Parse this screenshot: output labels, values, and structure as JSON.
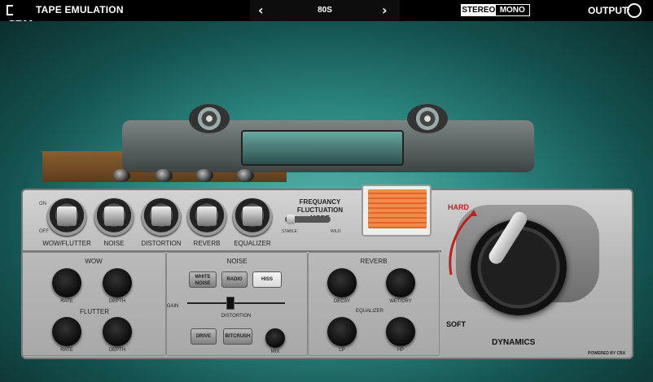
{
  "app": {
    "logo_text": "CBX",
    "title": "TAPE EMULATION"
  },
  "preset": {
    "prev_icon": "‹",
    "next_icon": "›",
    "name": "80S"
  },
  "channel_mode": {
    "options": [
      "STEREO",
      "MONO"
    ],
    "selected": "STEREO"
  },
  "output": {
    "label": "OUTPUT:"
  },
  "switches": {
    "on_label": "ON",
    "off_label": "OFF",
    "items": [
      {
        "label": "WOW/FLUTTER"
      },
      {
        "label": "NOISE"
      },
      {
        "label": "DISTORTION"
      },
      {
        "label": "REVERB"
      },
      {
        "label": "EQUALIZER"
      }
    ]
  },
  "freq_fluctuation": {
    "title": "FREQUANCY FLUCTUATION\nMODE",
    "stable_label": "STABLE",
    "wild_label": "WILD"
  },
  "wow_section": {
    "title": "WOW",
    "rate": "RATE",
    "depth": "DEPTH",
    "flutter_title": "FLUTTER",
    "flutter_rate": "RATE",
    "flutter_depth": "DEPTH"
  },
  "noise_section": {
    "title": "NOISE",
    "buttons": [
      "WHITE\nNOISE",
      "RADIO",
      "HISS"
    ],
    "active_button": "HISS",
    "gain_label": "GAIN",
    "distortion_label": "DISTORTION",
    "drive_label": "DRIVE",
    "bitcrush_label": "BITCRUSH",
    "mix_label": "MIX"
  },
  "reverb_section": {
    "title": "REVERB",
    "decay": "DECAY",
    "wetdry": "WET/DRY",
    "eq_title": "EQUALIZER",
    "lp": "LP",
    "hp": "HP"
  },
  "dynamics": {
    "hard_label": "HARD",
    "soft_label": "SOFT",
    "label": "DYNAMICS",
    "accent_color": "#c01f1f"
  },
  "footer": {
    "powered_by": "POWERED BY CBX"
  }
}
